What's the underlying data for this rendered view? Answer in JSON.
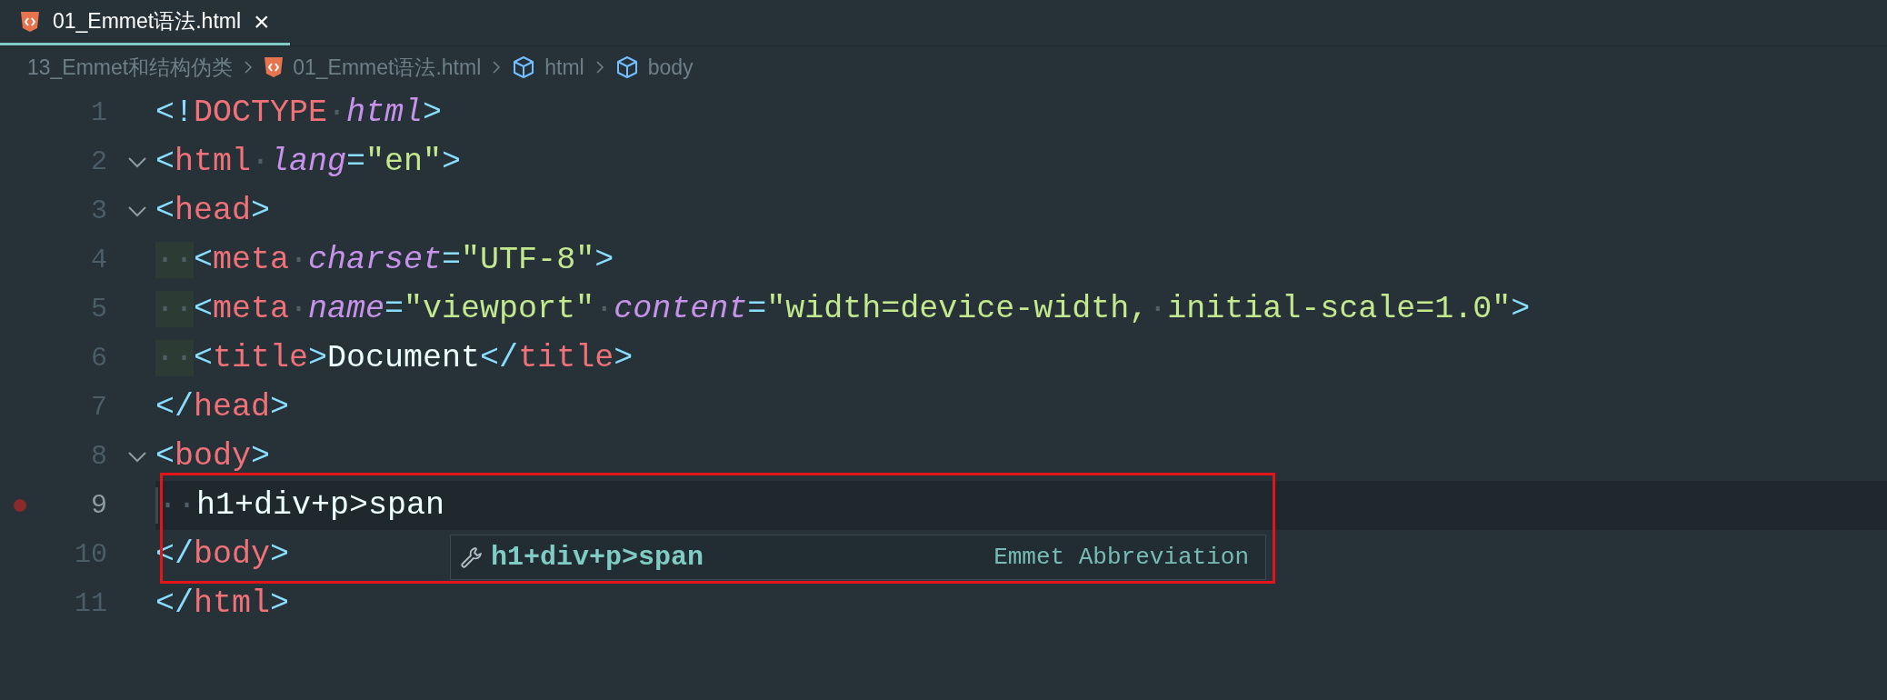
{
  "tabs": [
    {
      "label": "01_Emmet语法.html",
      "selected": true,
      "close": "×"
    }
  ],
  "breadcrumb": [
    {
      "kind": "folder",
      "label": "13_Emmet和结构伪类"
    },
    {
      "kind": "file",
      "label": "01_Emmet语法.html"
    },
    {
      "kind": "element",
      "label": "html"
    },
    {
      "kind": "element",
      "label": "body"
    }
  ],
  "lines": [
    {
      "number": "1",
      "current": false,
      "tokens": [
        {
          "kind": "punct",
          "text": "<!"
        },
        {
          "kind": "tag",
          "text": "DOCTYPE"
        },
        {
          "kind": "ws",
          "text": "·"
        },
        {
          "kind": "attr",
          "text": "html"
        },
        {
          "kind": "punct",
          "text": ">"
        }
      ]
    },
    {
      "number": "2",
      "foldable": true,
      "current": false,
      "tokens": [
        {
          "kind": "punct",
          "text": "<"
        },
        {
          "kind": "tag",
          "text": "html"
        },
        {
          "kind": "ws",
          "text": "·"
        },
        {
          "kind": "attr",
          "text": "lang"
        },
        {
          "kind": "punct",
          "text": "="
        },
        {
          "kind": "string",
          "text": "\"en\""
        },
        {
          "kind": "punct",
          "text": ">"
        }
      ]
    },
    {
      "number": "3",
      "foldable": true,
      "current": false,
      "tokens": [
        {
          "kind": "punct",
          "text": "<"
        },
        {
          "kind": "tag",
          "text": "head"
        },
        {
          "kind": "punct",
          "text": ">"
        }
      ]
    },
    {
      "number": "4",
      "current": false,
      "indent_highlight": true,
      "tokens": [
        {
          "kind": "indent",
          "text": "··"
        },
        {
          "kind": "punct",
          "text": "<"
        },
        {
          "kind": "tag",
          "text": "meta"
        },
        {
          "kind": "ws",
          "text": "·"
        },
        {
          "kind": "attr",
          "text": "charset"
        },
        {
          "kind": "punct",
          "text": "="
        },
        {
          "kind": "string",
          "text": "\"UTF-8\""
        },
        {
          "kind": "punct",
          "text": ">"
        }
      ]
    },
    {
      "number": "5",
      "current": false,
      "indent_highlight": true,
      "tokens": [
        {
          "kind": "indent",
          "text": "··"
        },
        {
          "kind": "punct",
          "text": "<"
        },
        {
          "kind": "tag",
          "text": "meta"
        },
        {
          "kind": "ws",
          "text": "·"
        },
        {
          "kind": "attr",
          "text": "name"
        },
        {
          "kind": "punct",
          "text": "="
        },
        {
          "kind": "string",
          "text": "\"viewport\""
        },
        {
          "kind": "ws",
          "text": "·"
        },
        {
          "kind": "attr",
          "text": "content"
        },
        {
          "kind": "punct",
          "text": "="
        },
        {
          "kind": "string",
          "text": "\"width=device-width,"
        },
        {
          "kind": "ws",
          "text": "·"
        },
        {
          "kind": "string",
          "text": "initial-scale=1.0\""
        },
        {
          "kind": "punct",
          "text": ">"
        }
      ]
    },
    {
      "number": "6",
      "current": false,
      "indent_highlight": true,
      "tokens": [
        {
          "kind": "indent",
          "text": "··"
        },
        {
          "kind": "punct",
          "text": "<"
        },
        {
          "kind": "tag",
          "text": "title"
        },
        {
          "kind": "punct",
          "text": ">"
        },
        {
          "kind": "text",
          "text": "Document"
        },
        {
          "kind": "punct",
          "text": "</"
        },
        {
          "kind": "tag",
          "text": "title"
        },
        {
          "kind": "punct",
          "text": ">"
        }
      ]
    },
    {
      "number": "7",
      "current": false,
      "tokens": [
        {
          "kind": "punct",
          "text": "</"
        },
        {
          "kind": "tag",
          "text": "head"
        },
        {
          "kind": "punct",
          "text": ">"
        }
      ]
    },
    {
      "number": "8",
      "foldable": true,
      "current": false,
      "tokens": [
        {
          "kind": "punct",
          "text": "<"
        },
        {
          "kind": "tag",
          "text": "body"
        },
        {
          "kind": "punct",
          "text": ">"
        }
      ]
    },
    {
      "number": "9",
      "current": true,
      "breakpoint": true,
      "tokens": [
        {
          "kind": "indent",
          "text": "··"
        },
        {
          "kind": "text",
          "text": "h1+div+p>span"
        }
      ]
    },
    {
      "number": "10",
      "current": false,
      "tokens": [
        {
          "kind": "punct",
          "text": "</"
        },
        {
          "kind": "tag",
          "text": "body"
        },
        {
          "kind": "punct",
          "text": ">"
        }
      ]
    },
    {
      "number": "11",
      "current": false,
      "tokens": [
        {
          "kind": "punct",
          "text": "</"
        },
        {
          "kind": "tag",
          "text": "html"
        },
        {
          "kind": "punct",
          "text": ">"
        }
      ]
    }
  ],
  "suggestion": {
    "label": "h1+div+p>span",
    "detail": "Emmet Abbreviation"
  },
  "annotation_box": true
}
